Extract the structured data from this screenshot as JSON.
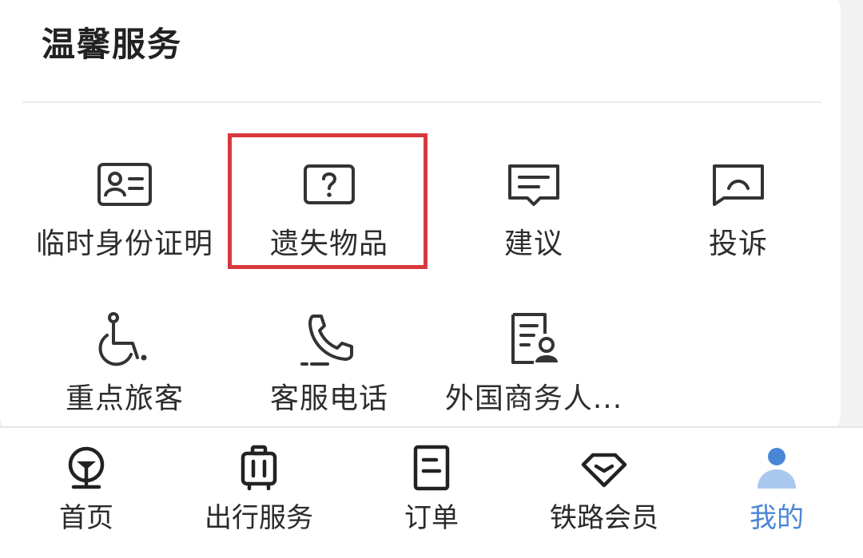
{
  "section": {
    "title": "温馨服务"
  },
  "services": [
    {
      "label": "临时身份证明",
      "icon": "id-card-icon"
    },
    {
      "label": "遗失物品",
      "icon": "question-box-icon"
    },
    {
      "label": "建议",
      "icon": "suggestion-chat-icon"
    },
    {
      "label": "投诉",
      "icon": "complaint-chat-icon"
    },
    {
      "label": "重点旅客",
      "icon": "wheelchair-icon"
    },
    {
      "label": "客服电话",
      "icon": "phone-icon"
    },
    {
      "label": "外国商务人...",
      "icon": "foreign-business-doc-icon"
    }
  ],
  "tabbar": {
    "tabs": [
      {
        "label": "首页",
        "icon": "railway-logo-icon"
      },
      {
        "label": "出行服务",
        "icon": "luggage-icon"
      },
      {
        "label": "订单",
        "icon": "order-document-icon"
      },
      {
        "label": "铁路会员",
        "icon": "diamond-icon"
      },
      {
        "label": "我的",
        "icon": "user-icon"
      }
    ],
    "active_color": "#4a86d8"
  },
  "colors": {
    "highlight_border": "#d8383d",
    "icon_stroke": "#333333"
  }
}
